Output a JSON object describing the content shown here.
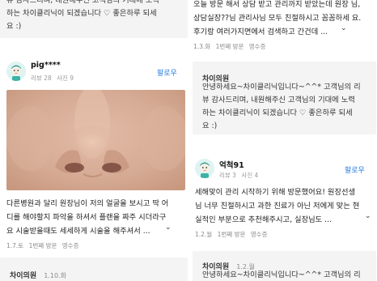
{
  "left": {
    "top_reply": {
      "lines": "뷰 감사드리며, 내원해주신 고객님의 기대에 노력\n하는 차이클리닉이 되겠습니다 ♡ 좋은하루 되세\n요 :)"
    },
    "review": {
      "username": "pig****",
      "review_count": "리뷰 28",
      "photo_count": "사진 9",
      "follow": "팔로우",
      "text": "다른병원과 달리 원장님이 저의 얼굴을 보시고 딱 어\n디를 해야할지 파악을 하셔서 플랜을 짜주 시더라구\n요 시술받을때도 세세하게 시술을 해주셔서 ...",
      "date": "1.7.토",
      "visit": "1번째 방문",
      "receipt": "영수증"
    },
    "bottom_reply": {
      "author": "차이의원",
      "date": "1.10.화"
    }
  },
  "right": {
    "top_review": {
      "text": "오늘 방문 해서 상담 받고 관리까지 받았는데 원장 님,\n상담실장??님 관리사님 모두 친절하시고 꼼꼼하세 요.\n후기랑 여러가지면에서 검색하고 간건데 ...",
      "date": "1.3.화",
      "visit": "1번째 방문",
      "receipt": "영수증"
    },
    "reply1": {
      "author": "차이의원",
      "lines": "안녕하세요~차이클리닉입니다~^^* 고객님의 리\n뷰 감사드리며, 내원해주신 고객님의 기대에 노력\n하는 차이클리닉이 되겠습니다 ♡ 좋은하루 되세\n요 :)"
    },
    "review2": {
      "username": "억척91",
      "review_count": "리뷰 3",
      "photo_count": "사진 4",
      "follow": "팔로우",
      "text": "세해맞이 관리 시작하기 위해 방문했어요! 원장선생\n님 너무 친절하시고 과한 진료가 아닌 저에게 맞는 현\n실적인 부분으로 추천해주시고, 실장님도 ...",
      "date": "1.2.월",
      "visit": "1번째 방문",
      "receipt": "영수증"
    },
    "reply2": {
      "author": "차이의원",
      "date": "1.2.월",
      "line": "안녕하세요~차이클리닉입니다~^^* 고객님의 리"
    }
  },
  "colors": {
    "follow": "#2a7ddb",
    "reply_bg": "#f4f4f4",
    "meta": "#8a8a8a",
    "avatar_bg": "#dff3f3"
  },
  "icons": {
    "expand": "chevron-down-icon",
    "avatar": "avatar-icon"
  }
}
